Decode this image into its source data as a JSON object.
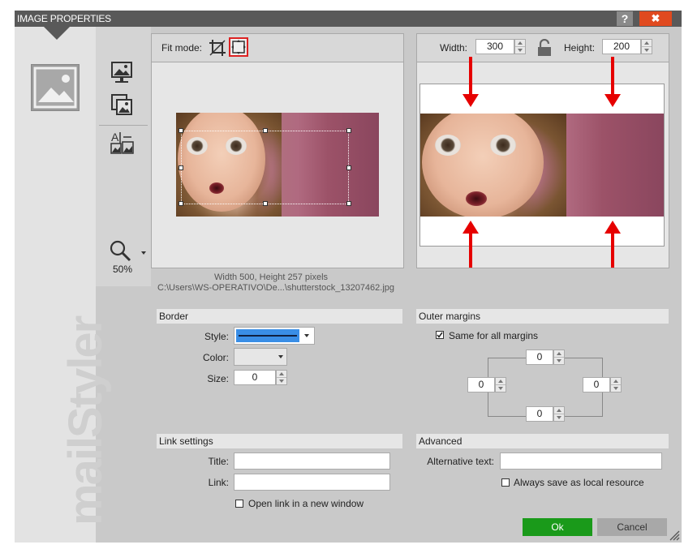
{
  "window": {
    "title": "IMAGE PROPERTIES",
    "help_label": "?",
    "close_label": "✖"
  },
  "brand": {
    "text": "mailStyler"
  },
  "toolbar": {
    "items": [
      {
        "name": "image-monitor-icon"
      },
      {
        "name": "image-replace-icon"
      },
      {
        "name": "image-text-icon"
      }
    ],
    "zoom_label": "50%"
  },
  "preview": {
    "fit_mode_label": "Fit mode:",
    "info_line": "Width  500, Height  257 pixels",
    "path_line": "C:\\Users\\WS-OPERATIVO\\De...\\shutterstock_13207462.jpg"
  },
  "size": {
    "width_label": "Width:",
    "width_value": "300",
    "height_label": "Height:",
    "height_value": "200"
  },
  "border": {
    "header": "Border",
    "style_label": "Style:",
    "color_label": "Color:",
    "size_label": "Size:",
    "size_value": "0",
    "style_color": "#3a8ee6"
  },
  "margins": {
    "header": "Outer margins",
    "same_label": "Same for all margins",
    "same_checked": true,
    "top": "0",
    "left": "0",
    "right": "0",
    "bottom": "0"
  },
  "link": {
    "header": "Link settings",
    "title_label": "Title:",
    "title_value": "",
    "link_label": "Link:",
    "link_value": "",
    "new_window_label": "Open link in a new window",
    "new_window_checked": false
  },
  "advanced": {
    "header": "Advanced",
    "alt_label": "Alternative text:",
    "alt_value": "",
    "local_label": "Always save as local resource",
    "local_checked": false
  },
  "footer": {
    "ok_label": "Ok",
    "cancel_label": "Cancel"
  },
  "colors": {
    "accent_green": "#1a9a1a",
    "close_red": "#e04a1f",
    "arrow_red": "#e60000"
  }
}
